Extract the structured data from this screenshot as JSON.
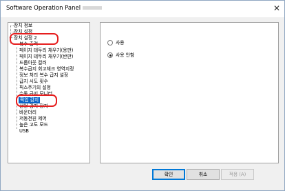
{
  "window": {
    "title": "Software Operation Panel",
    "close_glyph": "✕"
  },
  "tree": {
    "items": [
      {
        "label": "장치 정보"
      },
      {
        "label": "장치 설정"
      },
      {
        "label": "장치 설정 2"
      },
      {
        "label": "복수 출력"
      },
      {
        "label": "페이지 테두리 채우기(용판)"
      },
      {
        "label": "페이지 테두리 채우기(반판)"
      },
      {
        "label": "드롭아웃 컬러"
      },
      {
        "label": "복수급지 회고체크 영역지정"
      },
      {
        "label": "정보 처리 복수 급지 설정"
      },
      {
        "label": "급지 시도 횟수"
      },
      {
        "label": "픽스주기의 설정"
      },
      {
        "label": "수동 급지 모니터"
      },
      {
        "label": "픽업 감지"
      },
      {
        "label": "선언 감지 장지"
      },
      {
        "label": "바운더리"
      },
      {
        "label": "저동전원 제어"
      },
      {
        "label": "높은 고도 모드"
      },
      {
        "label": "USB"
      }
    ],
    "expander_glyph": "−"
  },
  "options": {
    "enable_label": "사용",
    "disable_label": "사용 안함",
    "selected": "disable"
  },
  "buttons": {
    "ok": "확인",
    "cancel": "취소",
    "apply": "적용 (A)"
  },
  "colors": {
    "selection": "#0a64c8",
    "highlight_annotation": "#e61e1e",
    "primary_border": "#0078d7"
  }
}
